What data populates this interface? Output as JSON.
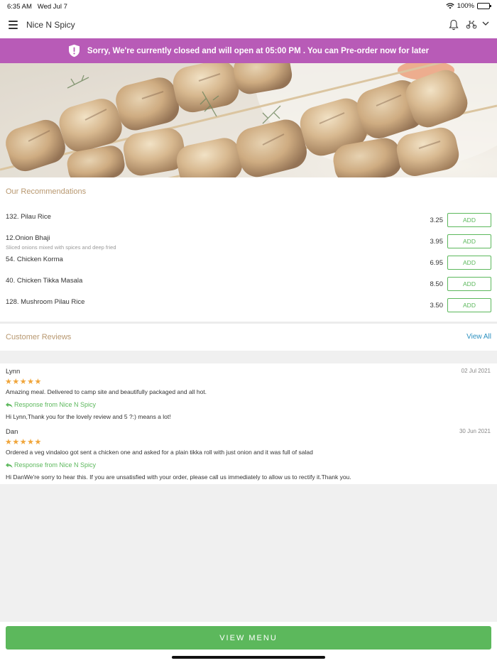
{
  "status_bar": {
    "time": "6:35 AM",
    "date": "Wed Jul 7",
    "battery": "100%"
  },
  "header": {
    "title": "Nice N Spicy"
  },
  "closed_banner": {
    "message": "Sorry, We're currently closed and will open at 05:00 PM . You can Pre-order now for later"
  },
  "recommendations": {
    "title": "Our Recommendations",
    "add_label": "ADD",
    "items": [
      {
        "name": "132. Pilau Rice",
        "description": "",
        "price": "3.25"
      },
      {
        "name": "12.Onion Bhaji",
        "description": "Sliced onions mixed with spices and deep fried",
        "price": "3.95"
      },
      {
        "name": "54. Chicken Korma",
        "description": "",
        "price": "6.95"
      },
      {
        "name": "40. Chicken Tikka Masala",
        "description": "",
        "price": "8.50"
      },
      {
        "name": "128. Mushroom Pilau Rice",
        "description": "",
        "price": "3.50"
      }
    ]
  },
  "reviews": {
    "title": "Customer Reviews",
    "view_all": "View All",
    "items": [
      {
        "author": "Lynn",
        "date": "02 Jul 2021",
        "rating": 5,
        "stars": "★★★★★",
        "text": "Amazing meal. Delivered to camp site and beautifully packaged and all hot.",
        "response_label": "Response from Nice N Spicy",
        "response": "Hi Lynn,Thank you for the lovely review and 5 ?:) means a lot!"
      },
      {
        "author": "Dan",
        "date": "30 Jun 2021",
        "rating": 5,
        "stars": "★★★★★",
        "text": "Ordered a veg vindaloo got sent a chicken one and asked for a plain tikka roll with just onion and it was full of salad",
        "response_label": "Response from Nice N Spicy",
        "response": "Hi DanWe're sorry to hear this. If you are unsatisfied with your order, please call us immediately to allow us to rectify it.Thank you."
      }
    ]
  },
  "footer": {
    "view_menu": "VIEW MENU"
  },
  "colors": {
    "banner": "#b85bb7",
    "accent_green": "#5cb85c",
    "star": "#f0a53a",
    "section_title": "#b89870",
    "link": "#2a8fbf"
  }
}
